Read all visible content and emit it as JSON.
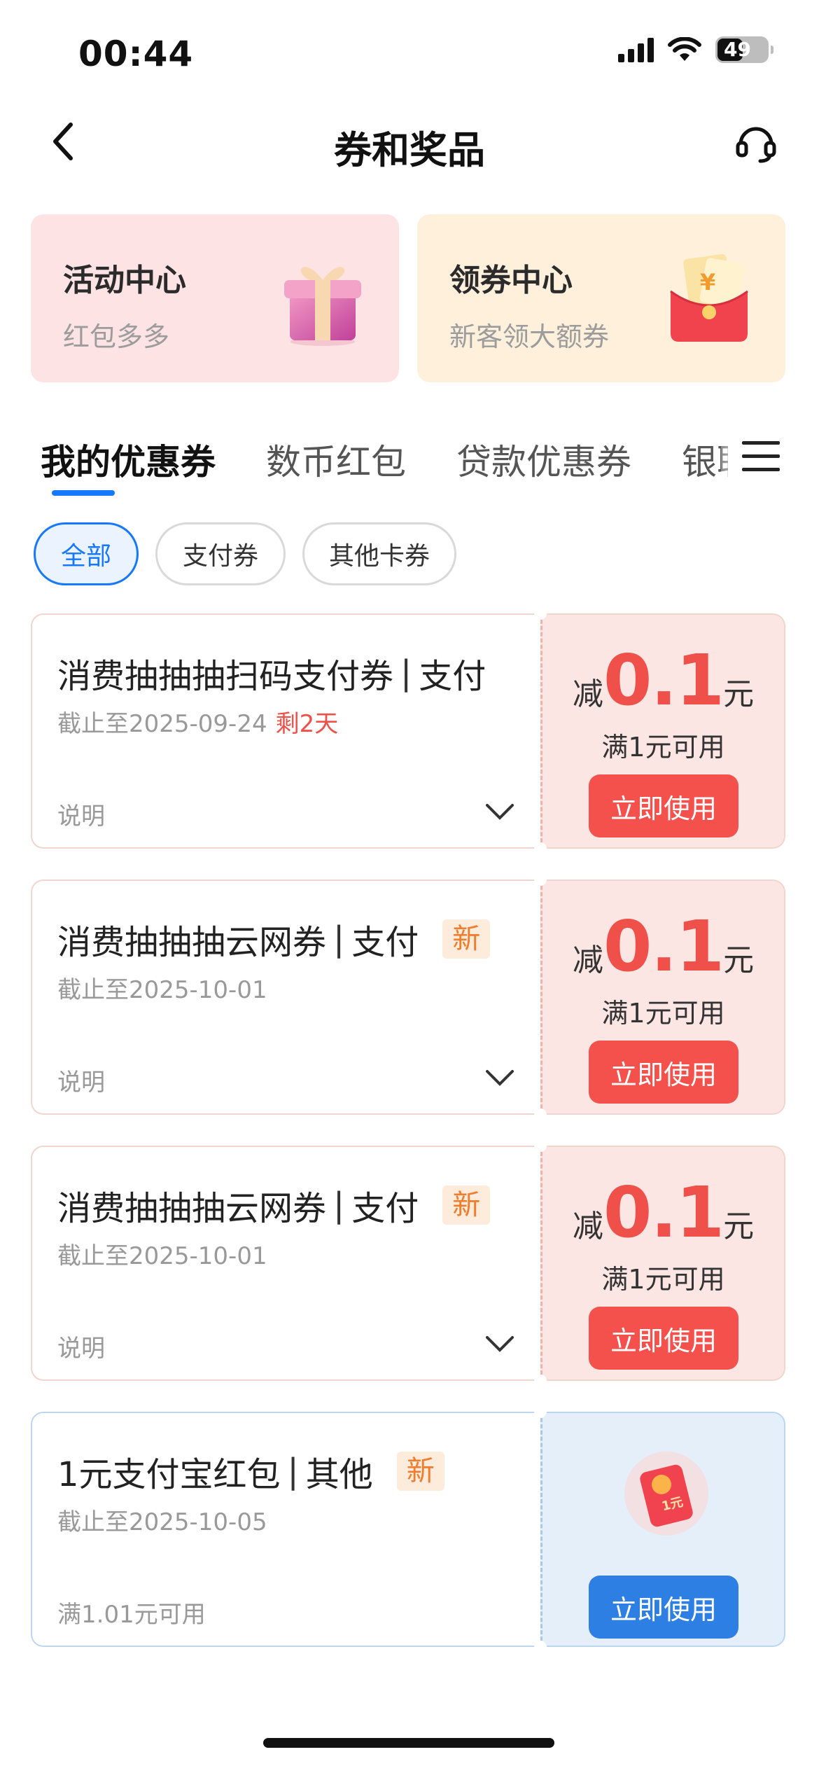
{
  "status_bar": {
    "time": "00:44",
    "battery": "49"
  },
  "nav": {
    "title": "券和奖品",
    "icons": [
      "back-icon",
      "customer-service-icon"
    ]
  },
  "promos": [
    {
      "title": "活动中心",
      "subtitle": "红包多多",
      "icon": "gift-box-icon"
    },
    {
      "title": "领券中心",
      "subtitle": "新客领大额券",
      "icon": "red-envelope-coupon-icon"
    }
  ],
  "tabs": [
    "我的优惠券",
    "数币红包",
    "贷款优惠券",
    "银联"
  ],
  "active_tab": 0,
  "chips": [
    "全部",
    "支付券",
    "其他卡券"
  ],
  "active_chip": 0,
  "coupons": [
    {
      "title_main": "消费抽抽抽扫码支付券",
      "title_type": "支付",
      "new": "",
      "date": "截止至2025-09-24",
      "remain": "剩2天",
      "note": "说明",
      "amount_prefix": "减",
      "amount": "0.1",
      "amount_unit": "元",
      "condition": "满1元可用",
      "button": "立即使用"
    },
    {
      "title_main": "消费抽抽抽云网券",
      "title_type": "支付",
      "new": "新",
      "date": "截止至2025-10-01",
      "remain": "",
      "note": "说明",
      "amount_prefix": "减",
      "amount": "0.1",
      "amount_unit": "元",
      "condition": "满1元可用",
      "button": "立即使用"
    },
    {
      "title_main": "消费抽抽抽云网券",
      "title_type": "支付",
      "new": "新",
      "date": "截止至2025-10-01",
      "remain": "",
      "note": "说明",
      "amount_prefix": "减",
      "amount": "0.1",
      "amount_unit": "元",
      "condition": "满1元可用",
      "button": "立即使用"
    },
    {
      "title_main": "1元支付宝红包",
      "title_type": "其他",
      "new": "新",
      "date": "截止至2025-10-05",
      "remain": "",
      "note": "满1.01元可用",
      "button": "立即使用",
      "icon": "red-envelope-icon",
      "icon_text": "1元"
    }
  ]
}
